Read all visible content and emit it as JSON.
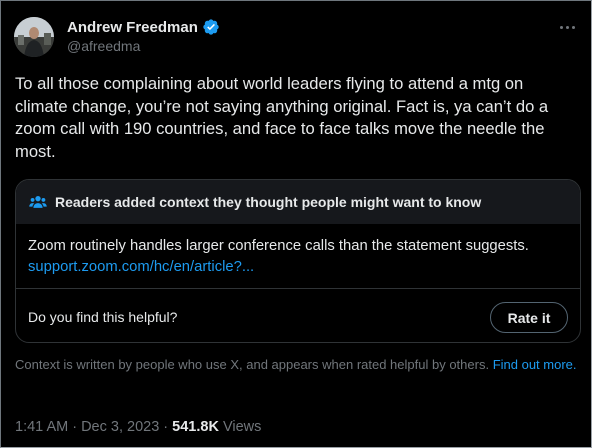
{
  "author": {
    "name": "Andrew Freedman",
    "handle": "@afreedma",
    "verified_icon": "verified-badge-icon",
    "avatar_icon": "profile-photo"
  },
  "more_icon": "more-horizontal-icon",
  "tweet": {
    "text": "To all those complaining about world leaders flying to attend a mtg on\nclimate change, you’re not saying anything original. Fact is, ya can’t do a\nzoom call with 190 countries, and face to face talks move the needle the\nmost."
  },
  "community_note": {
    "icon": "people-icon",
    "title": "Readers added context they thought people might want to know",
    "body": "Zoom routinely handles larger conference calls than the statement suggests.",
    "link": "support.zoom.com/hc/en/article?...",
    "helpful_question": "Do you find this helpful?",
    "rate_button": "Rate it"
  },
  "context_footer": {
    "text": "Context is written by people who use X, and appears when rated helpful by others.",
    "link": "Find out more."
  },
  "meta": {
    "time_date": "1:41 AM · Dec 3, 2023 · ",
    "views_count": "541.8K",
    "views_label": " Views"
  },
  "colors": {
    "background": "#000000",
    "text": "#e7e9ea",
    "secondary": "#71767b",
    "link": "#1d9bf0",
    "verified": "#1d9bf0"
  }
}
